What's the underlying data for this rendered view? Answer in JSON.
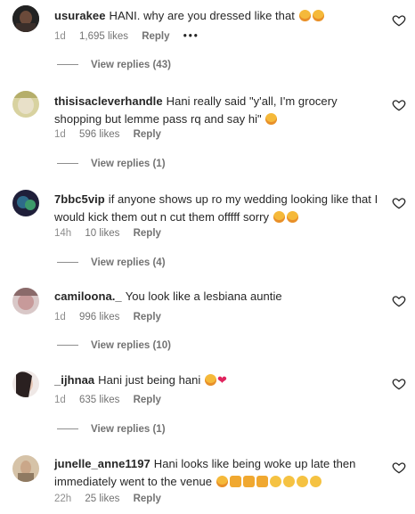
{
  "comments": [
    {
      "username": "usurakee",
      "text": "HANI. why are you dressed like that",
      "emojis": [
        "crying-face",
        "crying-face"
      ],
      "age": "1d",
      "likes": "1,695 likes",
      "reply": "Reply",
      "more": "•••",
      "replies": "View replies (43)"
    },
    {
      "username": "thisisacleverhandle",
      "text": "Hani really said \"y'all, I'm grocery shopping but lemme pass rq and say hi\"",
      "emojis": [
        "kissing-face"
      ],
      "age": "1d",
      "likes": "596 likes",
      "reply": "Reply",
      "replies": "View replies (1)"
    },
    {
      "username": "7bbc5vip",
      "text": "if anyone shows up ro my wedding looking like that I would kick them out n cut them offfff sorry",
      "emojis": [
        "crying-face",
        "crying-face"
      ],
      "age": "14h",
      "likes": "10 likes",
      "reply": "Reply",
      "replies": "View replies (4)"
    },
    {
      "username": "camiloona._",
      "text": "You look like a lesbiana auntie",
      "emojis": [],
      "age": "1d",
      "likes": "996 likes",
      "reply": "Reply",
      "replies": "View replies (10)"
    },
    {
      "username": "_ijhnaa",
      "text": "Hani just being hani",
      "emojis": [
        "crying-face",
        "red-heart"
      ],
      "age": "1d",
      "likes": "635 likes",
      "reply": "Reply",
      "replies": "View replies (1)"
    },
    {
      "username": "junelle_anne1197",
      "text": "Hani looks like being woke up late then immediately went to the venue",
      "emojis": [
        "crying-face",
        "cat-face",
        "cat-face",
        "cat-face",
        "pensive-face",
        "pensive-face",
        "pensive-face",
        "pensive-face"
      ],
      "age": "22h",
      "likes": "25 likes",
      "reply": "Reply"
    }
  ],
  "colors": {
    "text": "#262626",
    "meta": "#737373",
    "crying-face": "#f5b93a",
    "red-heart": "#e0245e"
  }
}
